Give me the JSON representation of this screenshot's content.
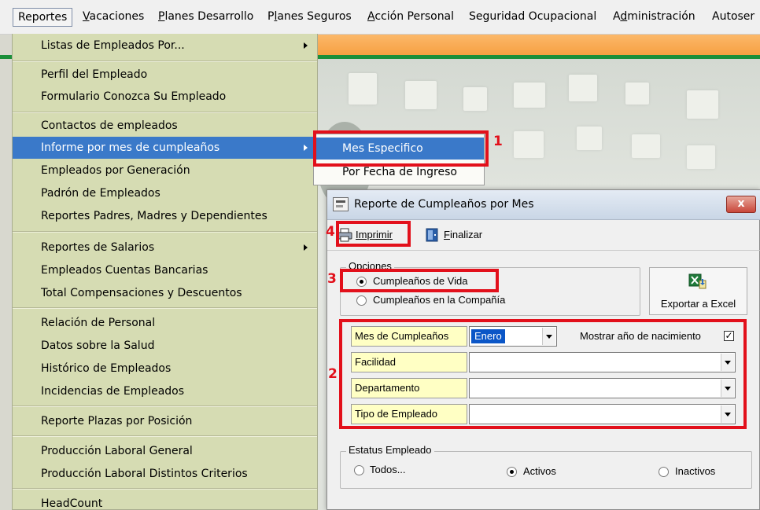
{
  "menubar": {
    "items": [
      {
        "label": "Reportes",
        "mnemonic_index": -1
      },
      {
        "label": "Vacaciones",
        "mnemonic_index": 0
      },
      {
        "label": "Planes Desarrollo",
        "mnemonic_index": 0
      },
      {
        "label": "Planes Seguros",
        "mnemonic_index": 1
      },
      {
        "label": "Acción Personal",
        "mnemonic_index": 0
      },
      {
        "label": "Seguridad Ocupacional",
        "mnemonic_index": -1
      },
      {
        "label": "Administración",
        "mnemonic_index": 1
      },
      {
        "label": "Autoser",
        "mnemonic_index": -1
      }
    ]
  },
  "dropdown": {
    "items": [
      {
        "label": "Listas de Empleados Por...",
        "submenu": true
      },
      {
        "label": "Perfil del Empleado"
      },
      {
        "label": "Formulario Conozca Su Empleado"
      },
      {
        "label": "Contactos de empleados"
      },
      {
        "label": "Informe por mes de cumpleaños",
        "submenu": true,
        "highlighted": true
      },
      {
        "label": "Empleados por Generación"
      },
      {
        "label": "Padrón de Empleados"
      },
      {
        "label": "Reportes Padres, Madres y Dependientes"
      },
      {
        "label": "Reportes de Salarios",
        "submenu": true
      },
      {
        "label": "Empleados Cuentas Bancarias"
      },
      {
        "label": "Total Compensaciones y Descuentos"
      },
      {
        "label": "Relación de Personal"
      },
      {
        "label": "Datos sobre la Salud"
      },
      {
        "label": "Histórico de Empleados"
      },
      {
        "label": "Incidencias de Empleados"
      },
      {
        "label": "Reporte Plazas por Posición"
      },
      {
        "label": "Producción Laboral General"
      },
      {
        "label": "Producción Laboral Distintos Criterios"
      },
      {
        "label": "HeadCount"
      }
    ]
  },
  "submenu": {
    "items": [
      {
        "label": "Mes Especifico",
        "highlighted": true
      },
      {
        "label": "Por Fecha de Ingreso"
      }
    ]
  },
  "callouts": [
    "1",
    "2",
    "3",
    "4"
  ],
  "dialog": {
    "title": "Reporte de Cumpleaños por Mes",
    "close_label": "x",
    "toolbar": {
      "print_label": "Imprimir",
      "finish_label": "Finalizar"
    },
    "options": {
      "legend": "Opciones",
      "birthday_life": "Cumpleaños de Vida",
      "birthday_company": "Cumpleaños en la Compañía",
      "selected": "birthday_life"
    },
    "export_label": "Exportar a Excel",
    "filters": {
      "month_label": "Mes de Cumpleaños",
      "month_value": "Enero",
      "show_birth_year_label": "Mostrar año de nacimiento",
      "show_birth_year_checked": true,
      "facility_label": "Facilidad",
      "facility_value": "",
      "department_label": "Departamento",
      "department_value": "",
      "employee_type_label": "Tipo de Empleado",
      "employee_type_value": ""
    },
    "status": {
      "legend": "Estatus Empleado",
      "all": "Todos...",
      "active": "Activos",
      "inactive": "Inactivos",
      "selected": "active"
    }
  },
  "colors": {
    "highlight": "#3a79c9",
    "menu_bg": "#d6dcb3",
    "callout_red": "#e2101b",
    "field_label_bg": "#ffffc4"
  }
}
